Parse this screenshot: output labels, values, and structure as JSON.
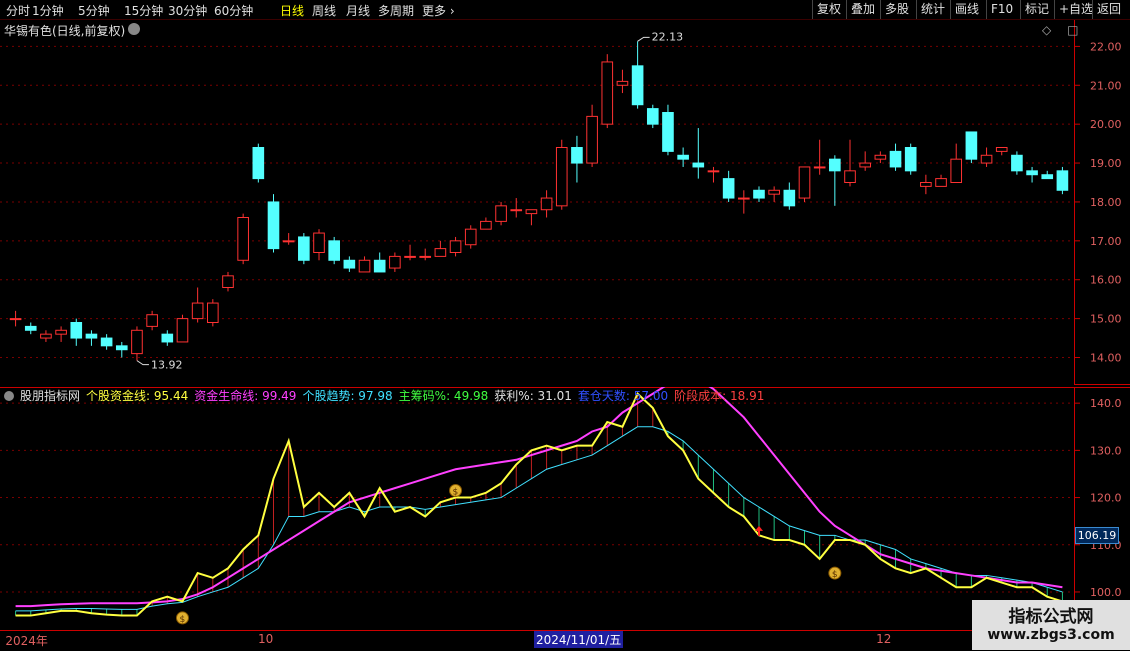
{
  "toolbar": {
    "period_tabs": [
      {
        "label": "分时",
        "active": false
      },
      {
        "label": "1分钟",
        "active": false
      },
      {
        "label": "5分钟",
        "active": false
      },
      {
        "label": "15分钟",
        "active": false
      },
      {
        "label": "30分钟",
        "active": false
      },
      {
        "label": "60分钟",
        "active": false
      },
      {
        "label": "日线",
        "active": true
      },
      {
        "label": "周线",
        "active": false
      },
      {
        "label": "月线",
        "active": false
      },
      {
        "label": "多周期",
        "active": false
      },
      {
        "label": "更多",
        "active": false
      }
    ],
    "tools": [
      "复权",
      "叠加",
      "多股",
      "统计",
      "画线",
      "F10",
      "标记",
      "+自选",
      "返回"
    ]
  },
  "stock": {
    "title": "华锡有色(日线,前复权)",
    "top_right_icons": [
      "diamond-icon",
      "square-icon"
    ]
  },
  "price_axis": {
    "labels": [
      "22.00",
      "21.00",
      "20.00",
      "19.00",
      "18.00",
      "17.00",
      "16.00",
      "15.00",
      "14.00"
    ],
    "values": [
      22,
      21,
      20,
      19,
      18,
      17,
      16,
      15,
      14
    ],
    "range": [
      13.55,
      22.55
    ]
  },
  "annotations": {
    "high": "22.13",
    "low": "13.92"
  },
  "indicator": {
    "name": "股朋指标网",
    "items": [
      {
        "label": "个股资金线: 95.44",
        "color": "#ffff40"
      },
      {
        "label": "资金生命线: 99.49",
        "color": "#ff40ff"
      },
      {
        "label": "个股趋势: 97.98",
        "color": "#40e0ff"
      },
      {
        "label": "主筹码%: 49.98",
        "color": "#40ff40"
      },
      {
        "label": "获利%: 31.01",
        "color": "#e0e0e0"
      },
      {
        "label": "套仓天数: 57.00",
        "color": "#3050ff"
      },
      {
        "label": "阶段成本: 18.91",
        "color": "#ff4040"
      }
    ],
    "axis_labels": [
      "140.0",
      "130.0",
      "120.0",
      "110.0",
      "100.0"
    ],
    "axis_values": [
      140,
      130,
      120,
      110,
      100
    ],
    "range": [
      93,
      143
    ],
    "current_tag": "106.19"
  },
  "time_axis": {
    "labels": [
      {
        "text": "2024年",
        "pos": 0.005
      },
      {
        "text": "10",
        "pos": 0.24
      },
      {
        "text": "12",
        "pos": 0.815
      }
    ],
    "highlight": "2024/11/01/五"
  },
  "watermark": {
    "title": "指标公式网",
    "url": "www.zbgs3.com"
  },
  "chart_data": [
    {
      "type": "candlestick",
      "title": "华锡有色(日线,前复权)",
      "ylim": [
        13.55,
        22.55
      ],
      "bars": [
        [
          15.0,
          15.0,
          15.2,
          14.8
        ],
        [
          14.8,
          14.7,
          14.9,
          14.6
        ],
        [
          14.5,
          14.6,
          14.7,
          14.4
        ],
        [
          14.6,
          14.7,
          14.8,
          14.4
        ],
        [
          14.9,
          14.5,
          15.0,
          14.3
        ],
        [
          14.6,
          14.5,
          14.7,
          14.3
        ],
        [
          14.5,
          14.3,
          14.6,
          14.2
        ],
        [
          14.3,
          14.2,
          14.4,
          14.0
        ],
        [
          14.1,
          14.7,
          14.8,
          13.92
        ],
        [
          14.8,
          15.1,
          15.2,
          14.7
        ],
        [
          14.6,
          14.4,
          14.7,
          14.3
        ],
        [
          14.4,
          15.0,
          15.1,
          14.4
        ],
        [
          15.0,
          15.4,
          15.8,
          14.9
        ],
        [
          14.9,
          15.4,
          15.5,
          14.8
        ],
        [
          15.8,
          16.1,
          16.2,
          15.7
        ],
        [
          16.5,
          17.6,
          17.7,
          16.4
        ],
        [
          19.4,
          18.6,
          19.5,
          18.5
        ],
        [
          18.0,
          16.8,
          18.2,
          16.7
        ],
        [
          17.0,
          17.0,
          17.2,
          16.9
        ],
        [
          17.1,
          16.5,
          17.2,
          16.4
        ],
        [
          16.7,
          17.2,
          17.3,
          16.5
        ],
        [
          17.0,
          16.5,
          17.1,
          16.4
        ],
        [
          16.5,
          16.3,
          16.6,
          16.2
        ],
        [
          16.2,
          16.5,
          16.6,
          16.2
        ],
        [
          16.5,
          16.2,
          16.7,
          16.2
        ],
        [
          16.3,
          16.6,
          16.7,
          16.2
        ],
        [
          16.6,
          16.6,
          16.9,
          16.5
        ],
        [
          16.6,
          16.6,
          16.8,
          16.5
        ],
        [
          16.6,
          16.8,
          17.0,
          16.6
        ],
        [
          16.7,
          17.0,
          17.1,
          16.6
        ],
        [
          16.9,
          17.3,
          17.4,
          16.8
        ],
        [
          17.3,
          17.5,
          17.6,
          17.3
        ],
        [
          17.5,
          17.9,
          18.0,
          17.4
        ],
        [
          17.8,
          17.8,
          18.1,
          17.6
        ],
        [
          17.7,
          17.8,
          17.8,
          17.4
        ],
        [
          17.8,
          18.1,
          18.3,
          17.6
        ],
        [
          17.9,
          19.4,
          19.6,
          17.8
        ],
        [
          19.4,
          19.0,
          19.7,
          18.5
        ],
        [
          19.0,
          20.2,
          20.5,
          18.9
        ],
        [
          20.0,
          21.6,
          21.8,
          19.9
        ],
        [
          21.0,
          21.1,
          21.4,
          20.8
        ],
        [
          21.5,
          20.5,
          22.13,
          20.4
        ],
        [
          20.4,
          20.0,
          20.5,
          19.9
        ],
        [
          20.3,
          19.3,
          20.5,
          19.2
        ],
        [
          19.2,
          19.1,
          19.4,
          18.9
        ],
        [
          19.0,
          18.9,
          19.9,
          18.6
        ],
        [
          18.8,
          18.8,
          18.9,
          18.5
        ],
        [
          18.6,
          18.1,
          18.8,
          18.0
        ],
        [
          18.1,
          18.1,
          18.3,
          17.7
        ],
        [
          18.3,
          18.1,
          18.4,
          18.0
        ],
        [
          18.2,
          18.3,
          18.4,
          18.0
        ],
        [
          18.3,
          17.9,
          18.5,
          17.8
        ],
        [
          18.1,
          18.9,
          18.9,
          18.0
        ],
        [
          18.9,
          18.9,
          19.6,
          18.7
        ],
        [
          19.1,
          18.8,
          19.2,
          17.9
        ],
        [
          18.5,
          18.8,
          19.6,
          18.4
        ],
        [
          18.9,
          19.0,
          19.3,
          18.8
        ],
        [
          19.1,
          19.2,
          19.3,
          19.0
        ],
        [
          19.3,
          18.9,
          19.5,
          18.8
        ],
        [
          19.4,
          18.8,
          19.5,
          18.7
        ],
        [
          18.4,
          18.5,
          18.7,
          18.2
        ],
        [
          18.4,
          18.6,
          18.7,
          18.4
        ],
        [
          18.5,
          19.1,
          19.5,
          18.5
        ],
        [
          19.8,
          19.1,
          19.8,
          19.0
        ],
        [
          19.0,
          19.2,
          19.4,
          18.9
        ],
        [
          19.3,
          19.4,
          19.4,
          19.2
        ],
        [
          19.2,
          18.8,
          19.3,
          18.7
        ],
        [
          18.8,
          18.7,
          18.9,
          18.5
        ],
        [
          18.7,
          18.6,
          18.8,
          18.6
        ],
        [
          18.8,
          18.3,
          18.9,
          18.2
        ]
      ]
    },
    {
      "type": "line",
      "ylim": [
        93,
        143
      ],
      "x_count": 70,
      "series": [
        {
          "name": "个股资金线",
          "color": "#ffff40",
          "values": [
            95,
            95,
            95.5,
            96,
            96,
            95.5,
            95.2,
            95,
            95,
            98,
            99,
            98,
            104,
            103,
            105,
            109,
            112,
            124,
            132,
            118,
            121,
            118,
            121,
            116,
            122,
            117,
            118,
            116,
            119,
            120,
            120,
            121,
            123,
            127,
            130,
            131,
            130,
            131,
            131,
            136,
            135,
            142,
            139,
            133,
            130,
            124,
            121,
            118,
            116,
            112,
            111,
            111,
            110,
            107,
            111,
            111,
            110,
            107,
            105,
            104,
            105,
            103,
            101,
            101,
            103,
            102,
            101,
            101,
            99,
            98
          ]
        },
        {
          "name": "资金生命线",
          "color": "#ff40ff",
          "values": [
            97,
            97,
            97.2,
            97.4,
            97.5,
            97.6,
            97.6,
            97.6,
            97.6,
            97.8,
            98,
            98.5,
            99.5,
            101,
            103,
            105,
            107,
            109,
            111,
            113,
            115,
            117,
            119,
            120,
            121,
            122,
            123,
            124,
            125,
            126,
            126.5,
            127,
            127.5,
            128,
            129,
            130,
            131,
            132,
            134,
            135,
            138,
            140,
            142,
            144,
            145,
            145,
            143,
            140,
            137,
            133,
            129,
            125,
            121,
            117,
            114,
            112,
            110,
            108,
            107,
            106,
            105,
            104.5,
            104,
            103.5,
            103,
            102.5,
            102,
            102,
            101.5,
            101
          ]
        },
        {
          "name": "个股趋势",
          "color": "#40e0ff",
          "values": [
            96,
            96,
            96.2,
            96.4,
            96.5,
            96.5,
            96.4,
            96.3,
            96.3,
            97,
            97.5,
            97.8,
            99,
            100,
            101,
            103,
            105,
            110,
            116,
            116,
            117,
            117,
            118,
            117,
            118,
            118,
            118,
            117.5,
            118,
            118.5,
            119,
            119.5,
            120,
            122,
            124,
            126,
            127,
            128,
            129,
            131,
            133,
            135,
            135,
            134,
            132,
            129,
            126,
            123,
            120,
            118,
            116,
            114,
            113,
            112,
            112,
            111,
            111,
            110,
            109,
            107,
            106,
            105,
            104,
            103.5,
            103.5,
            103,
            102.5,
            102,
            101,
            100
          ]
        }
      ]
    }
  ]
}
